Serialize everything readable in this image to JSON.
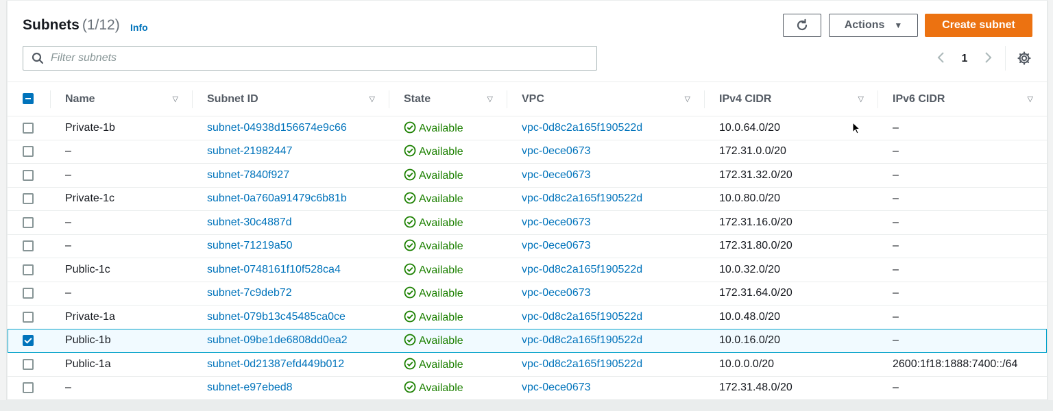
{
  "header": {
    "title": "Subnets",
    "count": "(1/12)",
    "info": "Info",
    "actions_label": "Actions",
    "create_label": "Create subnet",
    "filter_placeholder": "Filter subnets",
    "page": "1"
  },
  "icons": {
    "refresh": "refresh-icon",
    "search": "search-icon",
    "settings": "gear-icon",
    "prev": "chevron-left-icon",
    "next": "chevron-right-icon",
    "status": "status-success-icon"
  },
  "colors": {
    "accent": "#ec7211",
    "link": "#0073bb",
    "success": "#1d8102",
    "selected_bg": "#f1faff"
  },
  "columns": [
    "Name",
    "Subnet ID",
    "State",
    "VPC",
    "IPv4 CIDR",
    "IPv6 CIDR"
  ],
  "rows": [
    {
      "name": "Private-1b",
      "subnet_id": "subnet-04938d156674e9c66",
      "state": "Available",
      "vpc": "vpc-0d8c2a165f190522d",
      "ipv4": "10.0.64.0/20",
      "ipv6": "–",
      "selected": false
    },
    {
      "name": "–",
      "subnet_id": "subnet-21982447",
      "state": "Available",
      "vpc": "vpc-0ece0673",
      "ipv4": "172.31.0.0/20",
      "ipv6": "–",
      "selected": false
    },
    {
      "name": "–",
      "subnet_id": "subnet-7840f927",
      "state": "Available",
      "vpc": "vpc-0ece0673",
      "ipv4": "172.31.32.0/20",
      "ipv6": "–",
      "selected": false
    },
    {
      "name": "Private-1c",
      "subnet_id": "subnet-0a760a91479c6b81b",
      "state": "Available",
      "vpc": "vpc-0d8c2a165f190522d",
      "ipv4": "10.0.80.0/20",
      "ipv6": "–",
      "selected": false
    },
    {
      "name": "–",
      "subnet_id": "subnet-30c4887d",
      "state": "Available",
      "vpc": "vpc-0ece0673",
      "ipv4": "172.31.16.0/20",
      "ipv6": "–",
      "selected": false
    },
    {
      "name": "–",
      "subnet_id": "subnet-71219a50",
      "state": "Available",
      "vpc": "vpc-0ece0673",
      "ipv4": "172.31.80.0/20",
      "ipv6": "–",
      "selected": false
    },
    {
      "name": "Public-1c",
      "subnet_id": "subnet-0748161f10f528ca4",
      "state": "Available",
      "vpc": "vpc-0d8c2a165f190522d",
      "ipv4": "10.0.32.0/20",
      "ipv6": "–",
      "selected": false
    },
    {
      "name": "–",
      "subnet_id": "subnet-7c9deb72",
      "state": "Available",
      "vpc": "vpc-0ece0673",
      "ipv4": "172.31.64.0/20",
      "ipv6": "–",
      "selected": false
    },
    {
      "name": "Private-1a",
      "subnet_id": "subnet-079b13c45485ca0ce",
      "state": "Available",
      "vpc": "vpc-0d8c2a165f190522d",
      "ipv4": "10.0.48.0/20",
      "ipv6": "–",
      "selected": false
    },
    {
      "name": "Public-1b",
      "subnet_id": "subnet-09be1de6808dd0ea2",
      "state": "Available",
      "vpc": "vpc-0d8c2a165f190522d",
      "ipv4": "10.0.16.0/20",
      "ipv6": "–",
      "selected": true
    },
    {
      "name": "Public-1a",
      "subnet_id": "subnet-0d21387efd449b012",
      "state": "Available",
      "vpc": "vpc-0d8c2a165f190522d",
      "ipv4": "10.0.0.0/20",
      "ipv6": "2600:1f18:1888:7400::/64",
      "selected": false
    },
    {
      "name": "–",
      "subnet_id": "subnet-e97ebed8",
      "state": "Available",
      "vpc": "vpc-0ece0673",
      "ipv4": "172.31.48.0/20",
      "ipv6": "–",
      "selected": false
    }
  ]
}
